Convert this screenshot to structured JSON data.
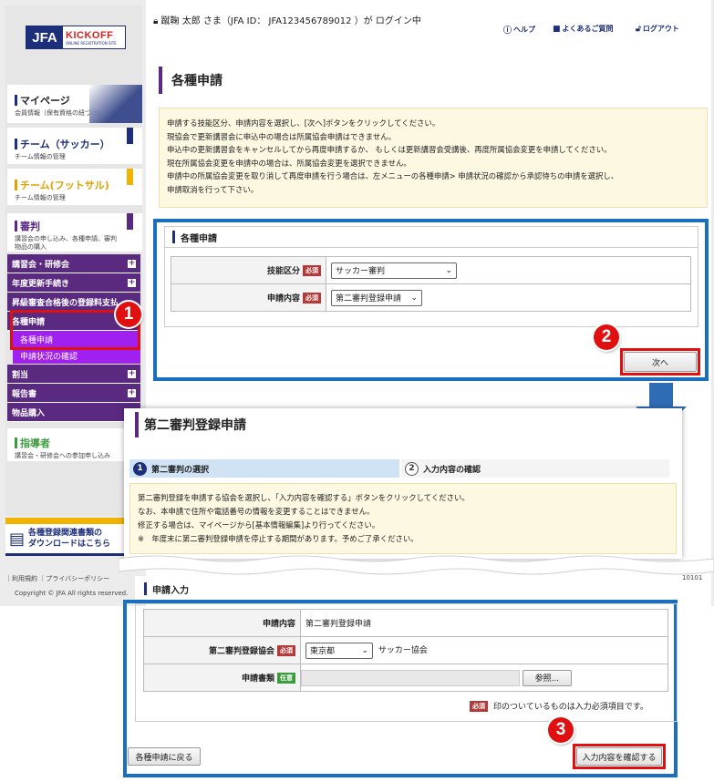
{
  "logo": {
    "jfa": "JFA",
    "kickoff": "KICKOFF",
    "sub": "ONLINE REGISTRATION SITE"
  },
  "header": {
    "login_status": "蹴鞠 太郎 さま（JFA ID： JFA123456789012 ）が ログイン中",
    "help": "ヘルプ",
    "faq": "よくあるご質問",
    "logout": "ログアウト"
  },
  "sidebar": {
    "mypage": {
      "title": "マイページ",
      "sub": "会員情報（保有資格の紐づけ）"
    },
    "soccer": {
      "title": "チーム（サッカー）",
      "sub": "チーム情報の管理"
    },
    "futsal": {
      "title": "チーム(フットサル)",
      "sub": "チーム情報の管理"
    },
    "referee": {
      "title": "審判",
      "sub": "講習会の申し込み、各種申請、審判物品の購入"
    },
    "menus": [
      {
        "label": "講習会・研修会"
      },
      {
        "label": "年度更新手続き"
      },
      {
        "label": "昇級審査合格後の登録料支払"
      },
      {
        "label": "各種申請"
      },
      {
        "label": "割当"
      },
      {
        "label": "報告書"
      },
      {
        "label": "物品購入"
      }
    ],
    "submenus": [
      {
        "label": "各種申請"
      },
      {
        "label": "申請状況の確認"
      }
    ],
    "coach": {
      "title": "指導者",
      "sub": "講習会・研修会への参加申し込み"
    },
    "download": {
      "line1": "各種登録関連書類の",
      "line2": "ダウンロードはこちら"
    },
    "footer_links": "｜利用規約 ｜プライバシーポリシー",
    "copyright": "Copyright © JFA All rights reserved.",
    "footer_num": "10101"
  },
  "page1": {
    "title": "各種申請",
    "info": [
      "申請する技能区分、申請内容を選択し、[次へ]ボタンをクリックしてください。",
      "現協会で更新講習会に申込中の場合は所属協会申請はできません。",
      "申込中の更新講習会をキャンセルしてから再度申請するか、 もしくは更新講習会受講後、再度所属協会変更を申請してください。",
      "現在所属協会変更を申請中の場合は、所属協会変更を選択できません。",
      "申請中の所属協会変更を取り消して再度申請を行う場合は、左メニューの各種申請> 申請状況の確認から承認待ちの申請を選択し、",
      "申請取消を行って下さい。"
    ],
    "section_title": "各種申請",
    "fields": {
      "skill_label": "技能区分",
      "skill_value": "サッカー審判",
      "content_label": "申請内容",
      "content_value": "第二審判登録申請"
    },
    "required": "必須",
    "next_button": "次へ"
  },
  "page2": {
    "title": "第二審判登録申請",
    "steps": [
      {
        "num": "1",
        "label": "第二審判の選択"
      },
      {
        "num": "2",
        "label": "入力内容の確認"
      }
    ],
    "info": [
      "第二審判登録を申請する協会を選択し、「入力内容を確認する」ボタンをクリックしてください。",
      "なお、本申請で住所や電話番号の情報を変更することはできません。",
      "修正する場合は、マイページから[基本情報編集]より行ってください。",
      "※　年度末に第二審判登録申請を停止する期間があります。予めご了承ください。"
    ],
    "section_title": "申請入力",
    "fields": {
      "content_label": "申請内容",
      "content_value": "第二審判登録申請",
      "assoc_label": "第二審判登録協会",
      "assoc_value": "東京都",
      "assoc_suffix": "サッカー協会",
      "doc_label": "申請書類",
      "browse_button": "参照..."
    },
    "required": "必須",
    "optional": "任意",
    "required_note": "印のついているものは入力必須項目です。",
    "back_button": "各種申請に戻る",
    "confirm_button": "入力内容を確認する"
  },
  "markers": {
    "one": "1",
    "two": "2",
    "three": "3"
  },
  "colors": {
    "frame_blue": "#1b6fbf",
    "highlight_red": "#e01010",
    "menu_purple": "#5a2a80",
    "submenu_purple": "#a020f0"
  }
}
